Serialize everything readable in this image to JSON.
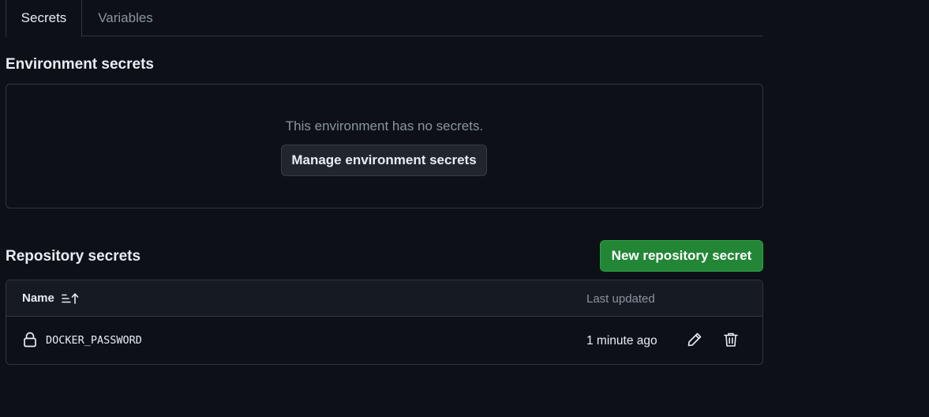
{
  "tabs": [
    {
      "label": "Secrets",
      "active": true
    },
    {
      "label": "Variables",
      "active": false
    }
  ],
  "environment": {
    "title": "Environment secrets",
    "empty_message": "This environment has no secrets.",
    "manage_label": "Manage environment secrets"
  },
  "repository": {
    "title": "Repository secrets",
    "new_label": "New repository secret",
    "columns": {
      "name": "Name",
      "updated": "Last updated"
    },
    "rows": [
      {
        "name": "DOCKER_PASSWORD",
        "updated": "1 minute ago"
      }
    ]
  },
  "colors": {
    "background": "#0d1117",
    "border": "#30363d",
    "primary_button": "#238636",
    "muted_text": "#8b949e"
  },
  "icons": {
    "sort": "sort-ascending-icon",
    "lock": "lock-icon",
    "edit": "pencil-icon",
    "delete": "trash-icon"
  }
}
